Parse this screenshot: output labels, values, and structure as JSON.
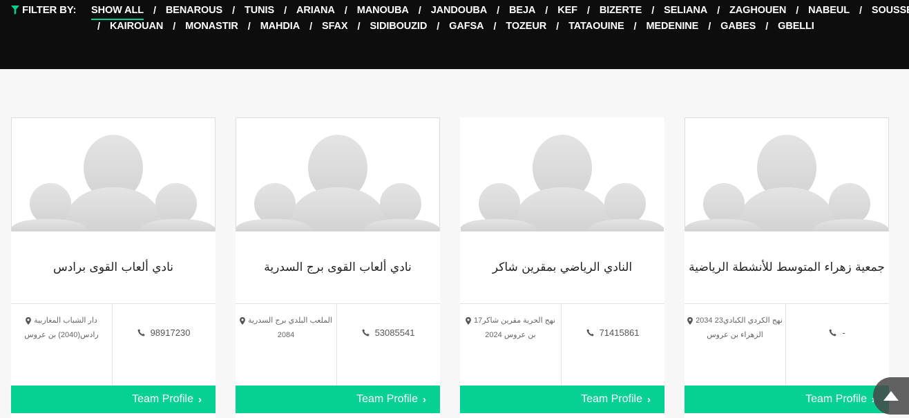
{
  "filter": {
    "label": "FILTER BY:",
    "row1": [
      "SHOW ALL",
      "BENAROUS",
      "TUNIS",
      "ARIANA",
      "MANOUBA",
      "JANDOUBA",
      "BEJA",
      "KEF",
      "BIZERTE",
      "SELIANA",
      "ZAGHOUEN",
      "NABEUL",
      "SOUSSE"
    ],
    "row2": [
      "KAIROUAN",
      "MONASTIR",
      "MAHDIA",
      "SFAX",
      "SIDIBOUZID",
      "GAFSA",
      "TOZEUR",
      "TATAOUINE",
      "MEDENINE",
      "GABES",
      "GBELLI"
    ],
    "separator": "/",
    "active": "SHOW ALL"
  },
  "cards": [
    {
      "name": "نادي ألعاب القوى برادس",
      "phone": "98917230",
      "address_line1": "دار الشباب المغاربية",
      "address_line2": "رادس(2040) بن عروس",
      "button": "Team Profile"
    },
    {
      "name": "نادي ألعاب القوى برج السدرية",
      "phone": "53085541",
      "address_line1": "الملعب البلدي برج السدرية",
      "address_line2": "2084",
      "button": "Team Profile"
    },
    {
      "name": "النادي الرياضي بمقرين شاكر",
      "phone": "71415861",
      "address_line1": "نهج الحرية مقرين شاكر17",
      "address_line2": "2024 بن عروس",
      "button": "Team Profile"
    },
    {
      "name": "جمعية زهراء المتوسط للأنشطة الرياضية",
      "phone": "-",
      "address_line1": "نهج الكردي الكبادي23 2034",
      "address_line2": "الزهراء بن عروس",
      "button": "Team Profile"
    }
  ],
  "colors": {
    "accent": "#05d192",
    "topbar": "#0d0d0d",
    "background": "#f7f7f7"
  },
  "icons": {
    "filter": "filter-funnel-icon",
    "phone": "phone-icon",
    "address": "map-pin-icon",
    "chevron": "chevron-right-icon",
    "scroll_top": "arrow-up-icon"
  }
}
